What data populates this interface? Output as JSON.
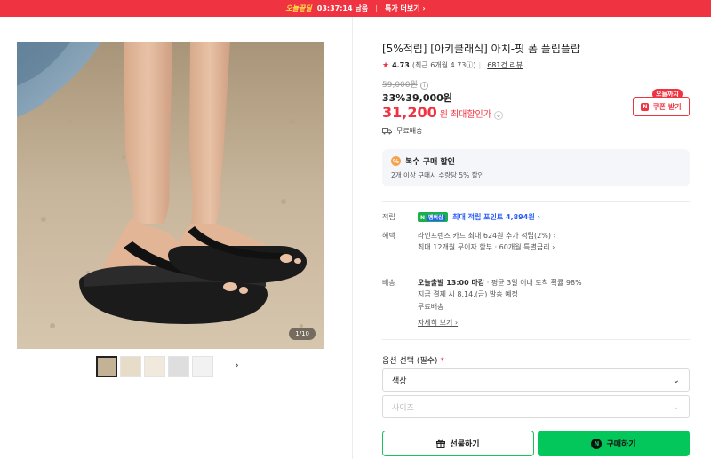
{
  "banner": {
    "brand": "오늘끝딜",
    "timer": "03:37:14 남음",
    "more": "특가 더보기 ›"
  },
  "gallery": {
    "counter": "1/10",
    "prev_icon": "chevron-left-icon",
    "next_icon": "chevron-right-icon"
  },
  "product": {
    "title": "[5%적립] [아키클래식] 아치-핏 폼 플립플랍",
    "rating": "4.73",
    "rating_detail": "(최근 6개월 4.73ⓘ)",
    "reviews": "681건 리뷰",
    "original_price": "59,000원",
    "discount": "33%39,000원",
    "max_price": "31,200",
    "max_price_unit": "원",
    "max_label": "최대할인가"
  },
  "coupon": {
    "tag": "오늘까지",
    "label": "쿠폰 받기"
  },
  "shipping_top": "무료배송",
  "multi": {
    "title": "복수 구매 할인",
    "sub": "2개 이상 구매시 수량당 5% 할인"
  },
  "points": {
    "label": "적립",
    "badge": "N",
    "badge2": "멤버십",
    "value": "최대 적립 포인트 4,894원 ›"
  },
  "benefit": {
    "label": "혜택",
    "line1": "라인프렌즈 카드 최대 624원 추가 적립(2%) ›",
    "line2": "최대 12개월 무이자 할부 · 60개월 특별금리 ›"
  },
  "delivery": {
    "label": "배송",
    "line1a": "오늘출발 13:00 마감",
    "line1b": "· 평균 3일 이내 도착 확률 98%",
    "line2": "지금 결제 시 8.14.(금) 발송 예정",
    "line3": "무료배송",
    "more": "자세히 보기 ›"
  },
  "options": {
    "label": "옵션 선택 (필수)",
    "required_mark": "*",
    "color_placeholder": "색상",
    "size_placeholder": "사이즈"
  },
  "actions": {
    "gift": "선물하기",
    "buy": "구매하기"
  },
  "colors": {
    "accent": "#ef3340",
    "npay": "#03c75a"
  }
}
